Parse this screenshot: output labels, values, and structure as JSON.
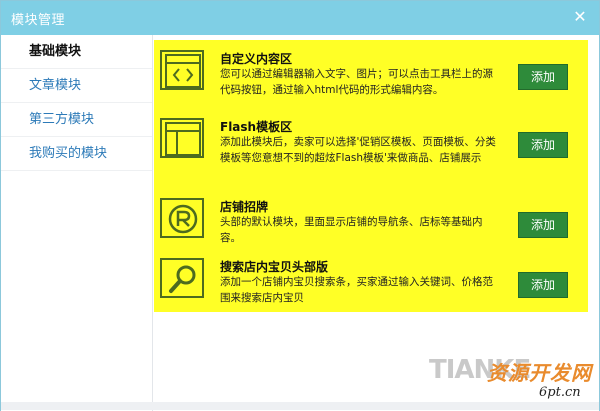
{
  "window": {
    "title": "模块管理",
    "close_glyph": "✕"
  },
  "sidebar": {
    "items": [
      {
        "label": "基础模块",
        "active": true
      },
      {
        "label": "文章模块",
        "active": false
      },
      {
        "label": "第三方模块",
        "active": false
      },
      {
        "label": "我购买的模块",
        "active": false
      }
    ]
  },
  "modules": [
    {
      "icon": "code-window-icon",
      "title": "自定义内容区",
      "desc": "您可以通过编辑器输入文字、图片；可以点击工具栏上的源代码按钮，通过输入html代码的形式编辑内容。",
      "add_label": "添加"
    },
    {
      "icon": "layout-template-icon",
      "title": "Flash模板区",
      "desc": "添加此模块后，卖家可以选择'促销区模板、页面模板、分类模板等您意想不到的超炫Flash模板'来做商品、店铺展示",
      "add_label": "添加"
    },
    {
      "icon": "registered-mark-icon",
      "title": "店铺招牌",
      "desc": "头部的默认模块，里面显示店铺的导航条、店标等基础内容。",
      "add_label": "添加"
    },
    {
      "icon": "search-magnifier-icon",
      "title": "搜索店内宝贝头部版",
      "desc": "添加一个店铺内宝贝搜索条，买家通过输入关键词、价格范围来搜索店内宝贝",
      "add_label": "添加"
    }
  ],
  "watermark": {
    "latin": "TIANKE",
    "cn": "资源开发网",
    "url": "6pt.cn"
  },
  "colors": {
    "titlebar": "#7fcfe5",
    "panel": "#ffff26",
    "button": "#2e8b3a",
    "icon_stroke": "#4d6b1f",
    "link": "#2c7ab8"
  }
}
